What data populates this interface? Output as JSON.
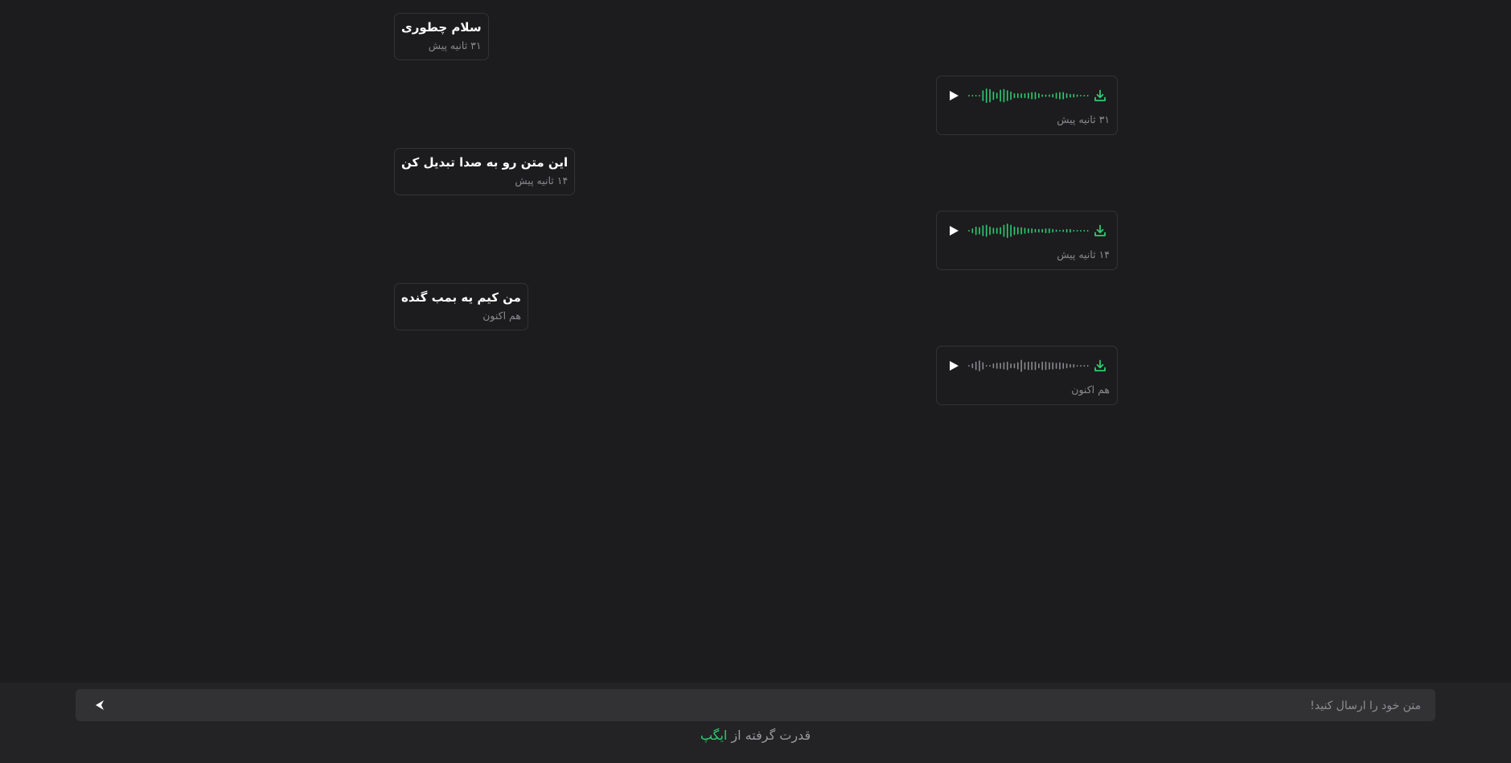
{
  "messages": [
    {
      "text": "سلام چطوری",
      "time": "۳۱ ثانیه پیش"
    },
    {
      "text": "این متن رو به صدا تبدیل کن",
      "time": "۱۴ ثانیه پیش"
    },
    {
      "text": "من کیم یه بمب گنده",
      "time": "هم اکنون"
    }
  ],
  "audio": [
    {
      "time": "۳۱ ثانیه پیش",
      "played_fraction": 1.0,
      "icons": [
        "play-icon",
        "waveform",
        "download-icon"
      ]
    },
    {
      "time": "۱۴ ثانیه پیش",
      "played_fraction": 1.0,
      "icons": [
        "play-icon",
        "waveform",
        "download-icon"
      ]
    },
    {
      "time": "هم اکنون",
      "played_fraction": 0.0,
      "icons": [
        "play-icon",
        "waveform",
        "download-icon"
      ]
    }
  ],
  "composer": {
    "placeholder": "متن خود را ارسال کنید!",
    "send_icon": "send-arrow-icon"
  },
  "footer": {
    "powered_prefix": "قدرت گرفته از",
    "brand": "ایگپ"
  },
  "colors": {
    "background": "#1c1c1e",
    "accent": "#2ecc71",
    "wave_idle": "#8a8a8e",
    "border": "#333336",
    "input_bg": "#323234",
    "footer_bg": "#232325"
  }
}
